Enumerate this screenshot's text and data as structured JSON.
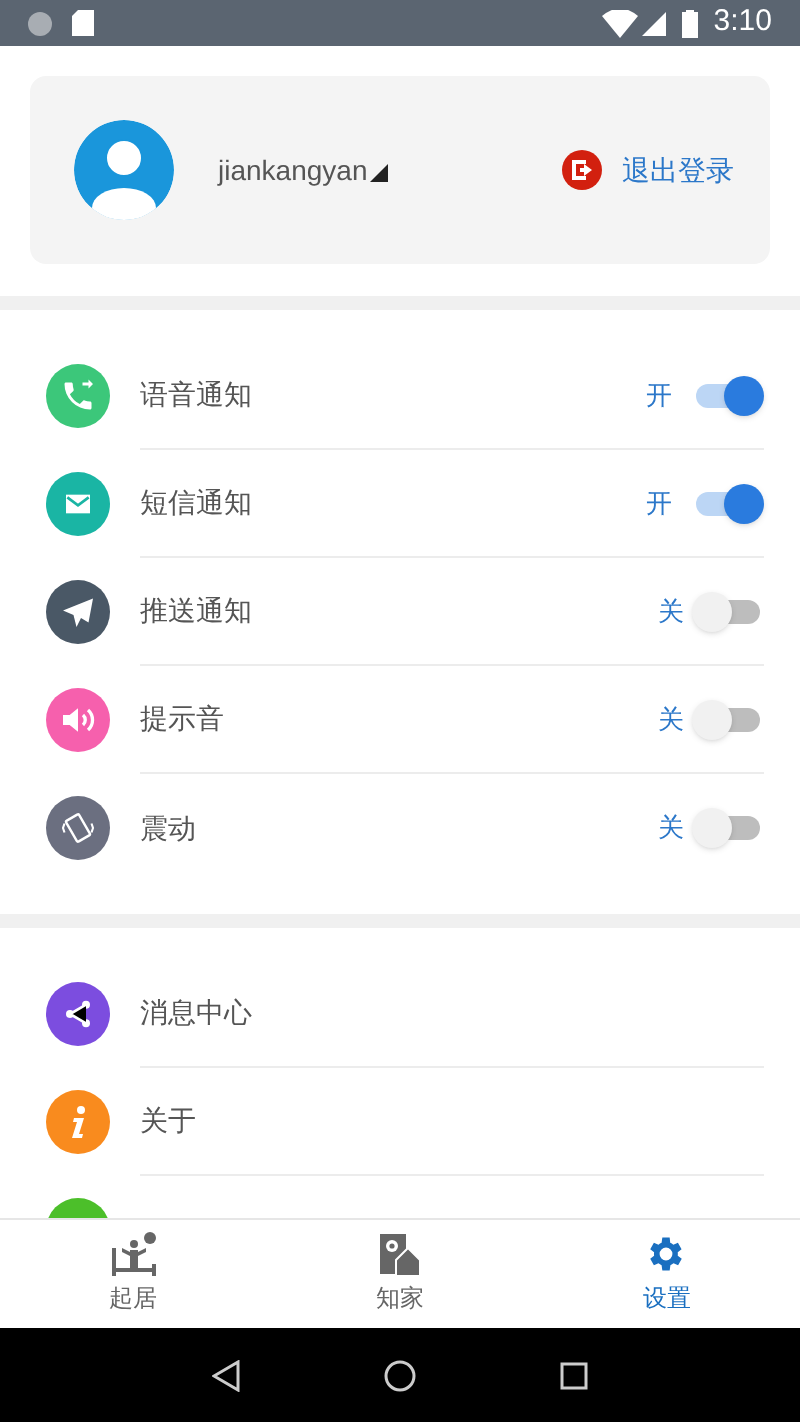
{
  "status_bar": {
    "time": "3:10"
  },
  "profile": {
    "username": "jiankangyan",
    "logout": "退出登录"
  },
  "notifications": [
    {
      "label": "语音通知",
      "status": "开",
      "on": true,
      "color": "#3cc77a"
    },
    {
      "label": "短信通知",
      "status": "开",
      "on": true,
      "color": "#1ab5a4"
    },
    {
      "label": "推送通知",
      "status": "关",
      "on": false,
      "color": "#4a5866"
    },
    {
      "label": "提示音",
      "status": "关",
      "on": false,
      "color": "#f660ad"
    },
    {
      "label": "震动",
      "status": "关",
      "on": false,
      "color": "#6b6f80"
    }
  ],
  "menu": [
    {
      "label": "消息中心",
      "color": "#7c4ddf"
    },
    {
      "label": "关于",
      "color": "#f98b1e"
    },
    {
      "color": "#4cbf2a"
    }
  ],
  "tabs": [
    {
      "label": "起居",
      "selected": false
    },
    {
      "label": "知家",
      "selected": false
    },
    {
      "label": "设置",
      "selected": true
    }
  ]
}
